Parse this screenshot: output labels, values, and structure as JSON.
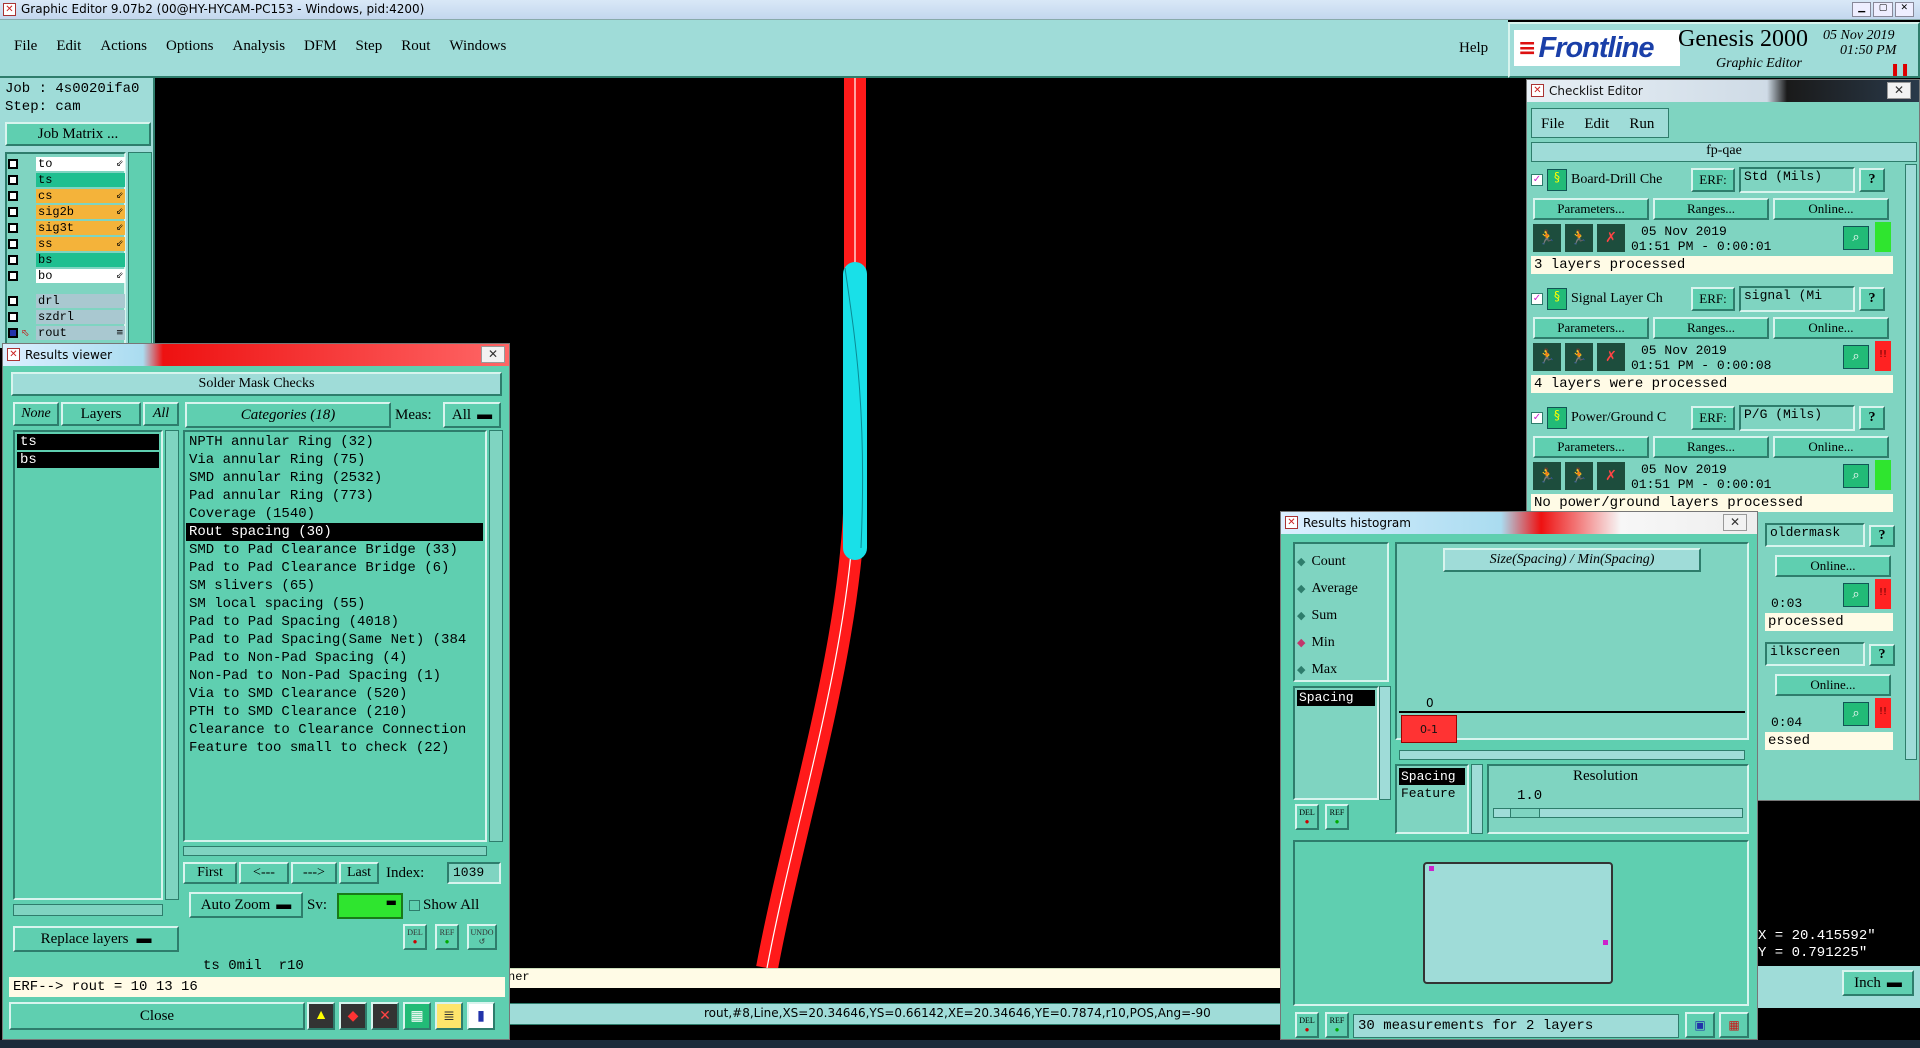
{
  "app_title": "Graphic Editor 9.07b2 (00@HY-HYCAM-PC153 - Windows, pid:4200)",
  "menu": [
    "File",
    "Edit",
    "Actions",
    "Options",
    "Analysis",
    "DFM",
    "Step",
    "Rout",
    "Windows"
  ],
  "help_label": "Help",
  "brand": {
    "logo": "Frontline",
    "product": "Genesis 2000",
    "subtitle": "Graphic Editor",
    "date": "05 Nov 2019",
    "time": "01:50 PM"
  },
  "job": {
    "job_label": "Job : 4s0020ifa0",
    "step_label": "Step: cam",
    "matrix_button": "Job Matrix ..."
  },
  "layers": [
    {
      "name": "to",
      "color": "#ffffff",
      "flag": "⇙"
    },
    {
      "name": "ts",
      "color": "#1fbf90",
      "flag": ""
    },
    {
      "name": "cs",
      "color": "#f4b33a",
      "flag": "⇙"
    },
    {
      "name": "sig2b",
      "color": "#f4b33a",
      "flag": "⇙"
    },
    {
      "name": "sig3t",
      "color": "#f4b33a",
      "flag": "⇙"
    },
    {
      "name": "ss",
      "color": "#f4b33a",
      "flag": "⇙"
    },
    {
      "name": "bs",
      "color": "#1fbf90",
      "flag": ""
    },
    {
      "name": "bo",
      "color": "#ffffff",
      "flag": "⇙"
    },
    {
      "name": "drl",
      "color": "#a9c8d0",
      "flag": ""
    },
    {
      "name": "szdrl",
      "color": "#a9c8d0",
      "flag": ""
    },
    {
      "name": "rout",
      "color": "#a9c8d0",
      "flag": "≡"
    }
  ],
  "results_viewer": {
    "title": "Results viewer",
    "header": "Solder Mask Checks",
    "btn_none": "None",
    "btn_layers": "Layers",
    "btn_all": "All",
    "categories_label": "Categories (18)",
    "meas_label": "Meas:",
    "meas_value": "All",
    "layer_list": [
      "ts",
      "bs"
    ],
    "categories": [
      "NPTH annular Ring (32)",
      "Via annular Ring (75)",
      "SMD annular Ring (2532)",
      "Pad annular Ring (773)",
      "Coverage (1540)",
      "Rout spacing (30)",
      "SMD to Pad Clearance Bridge (33)",
      "Pad to Pad Clearance Bridge (6)",
      "SM slivers (65)",
      "SM local spacing (55)",
      "Pad to Pad Spacing (4018)",
      "Pad to Pad Spacing(Same Net) (384",
      "Pad to Non-Pad Spacing (4)",
      "Non-Pad to Non-Pad Spacing (1)",
      "Via to SMD Clearance (520)",
      "PTH to SMD Clearance (210)",
      "Clearance to Clearance Connection",
      "Feature too small to check (22)"
    ],
    "selected_index": 5,
    "nav": {
      "first": "First",
      "prev": "<---",
      "next": "--->",
      "last": "Last",
      "index_label": "Index:",
      "index_value": "1039"
    },
    "auto_zoom": "Auto Zoom",
    "sv_label": "Sv:",
    "show_all": "Show All",
    "replace_layers": "Replace layers",
    "icons": {
      "del": "DEL",
      "ref": "REF",
      "undo": "UNDO"
    },
    "status": "ts 0mil  r10",
    "erf": "ERF--> rout = 10 13 16",
    "close": "Close"
  },
  "checklist": {
    "title": "Checklist Editor",
    "menu": [
      "File",
      "Edit",
      "Run"
    ],
    "name": "fp-qae",
    "erf_label": "ERF:",
    "params": "Parameters...",
    "ranges": "Ranges...",
    "online": "Online...",
    "items": [
      {
        "name": "Board-Drill Che",
        "erf": "Std (Mils)",
        "date": "05 Nov 2019",
        "time": "01:51 PM - 0:00:01",
        "status": "3 layers processed",
        "ok": true
      },
      {
        "name": "Signal Layer Ch",
        "erf": "signal (Mi",
        "date": "05 Nov 2019",
        "time": "01:51 PM - 0:00:08",
        "status": "4 layers were processed",
        "ok": false
      },
      {
        "name": "Power/Ground C",
        "erf": "P/G (Mils)",
        "date": "05 Nov 2019",
        "time": "01:51 PM - 0:00:01",
        "status": "No power/ground layers processed",
        "ok": true
      }
    ],
    "partial": [
      {
        "erf": "oldermask",
        "time": "0:03",
        "status": "processed",
        "online": "Online..."
      },
      {
        "erf": "ilkscreen",
        "time": "0:04",
        "status": "essed",
        "online": "Online..."
      }
    ]
  },
  "histogram": {
    "title": "Results histogram",
    "options": [
      "Count",
      "Average",
      "Sum",
      "Min",
      "Max"
    ],
    "selected": "Min",
    "chart_title": "Size(Spacing) / Min(Spacing)",
    "list": [
      "Spacing"
    ],
    "zero_label": "0",
    "bin_label": "0-1",
    "attr_list": [
      "Spacing",
      "Feature"
    ],
    "resolution_label": "Resolution",
    "resolution_value": "1.0",
    "measurements": "30 measurements for 2 layers"
  },
  "coords": {
    "x": "X = 20.415592\"",
    "y": "Y = 0.791225\""
  },
  "unit": "Inch",
  "bottom_msg": "ner",
  "status_bar": "rout,#8,Line,XS=20.34646,YS=0.66142,XE=20.34646,YE=0.7874,r10,POS,Ang=-90"
}
